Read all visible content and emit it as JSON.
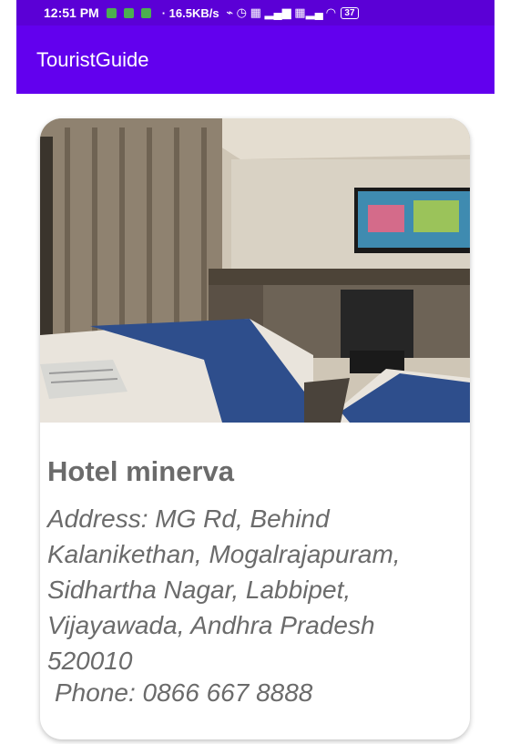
{
  "status_bar": {
    "time": "12:51 PM",
    "network_speed": "· 16.5KB/s",
    "battery": "37",
    "background": "#5b00d6"
  },
  "app_bar": {
    "title": "TouristGuide",
    "background": "#6200ee"
  },
  "card": {
    "image_icon": "hotel-room-photo",
    "name": "Hotel minerva",
    "address": "Address: MG Rd, Behind Kalanikethan, Mogalrajapuram, Sidhartha Nagar, Labbipet, Vijayawada, Andhra Pradesh 520010",
    "phone": "Phone: 0866 667 8888",
    "text_color": "#6b6b6b"
  }
}
